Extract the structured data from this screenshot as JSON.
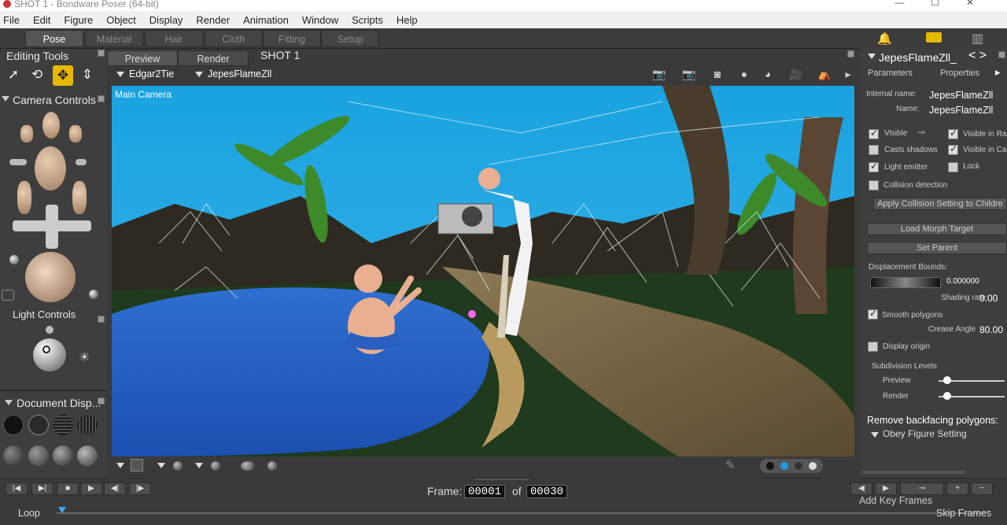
{
  "window": {
    "title": "SHOT 1 - Bondware Poser (64-bit)"
  },
  "menu": [
    "File",
    "Edit",
    "Figure",
    "Object",
    "Display",
    "Render",
    "Animation",
    "Window",
    "Scripts",
    "Help"
  ],
  "rooms": [
    "Pose",
    "Material",
    "Hair",
    "Cloth",
    "Fitting",
    "Setup"
  ],
  "left": {
    "editing_tools": "Editing Tools",
    "camera_controls": "Camera Controls",
    "light_controls": "Light Controls",
    "document_display": "Document  Disp..."
  },
  "viewport": {
    "tabs": [
      "Preview",
      "Render"
    ],
    "shot": "SHOT 1",
    "figure_select": "Edgar2Tie",
    "actor_select": "JepesFlameZll",
    "camera_label": "Main Camera"
  },
  "right": {
    "object_name": "JepesFlameZll_",
    "tabs": [
      "Parameters",
      "Properties"
    ],
    "internal_name_label": "Internal name:",
    "internal_name": "JepesFlameZll",
    "name_label": "Name:",
    "name": "JepesFlameZll",
    "visible": "Visible",
    "visible_in_render": "Visible in Ra",
    "casts_shadows": "Casts shadows",
    "visible_in_camera": "Visible in Ca",
    "light_emitter": "Light emitter",
    "lock": "Lock",
    "collision": "Collision detection",
    "apply_collision": "Apply Collision Setting to Childre",
    "load_morph": "Load Morph Target",
    "set_parent": "Set Parent",
    "displacement_bounds": "Displacement Bounds:",
    "displacement_value": "0.000000",
    "shading_rate_label": "Shading rate:",
    "shading_rate": "0.00",
    "smooth_polygons": "Smooth polygons",
    "crease_angle_label": "Crease Angle",
    "crease_angle": "80.00",
    "display_origin": "Display origin",
    "subdivision_levels": "Subdivision Levels",
    "preview": "Preview",
    "render": "Render",
    "remove_backfacing": "Remove backfacing polygons:",
    "obey_figure": "Obey Figure Setting",
    "checks": {
      "visible": true,
      "visible_in_render": true,
      "casts_shadows": false,
      "visible_in_camera": true,
      "light_emitter": true,
      "lock": false,
      "collision": false,
      "smooth_polygons": true,
      "display_origin": false
    }
  },
  "timeline": {
    "frame_label": "Frame:",
    "current_frame": "00001",
    "of_label": "of",
    "total_frames": "00030",
    "loop": "Loop",
    "add_key_frames": "Add Key Frames",
    "skip_frames": "Skip Frames"
  }
}
